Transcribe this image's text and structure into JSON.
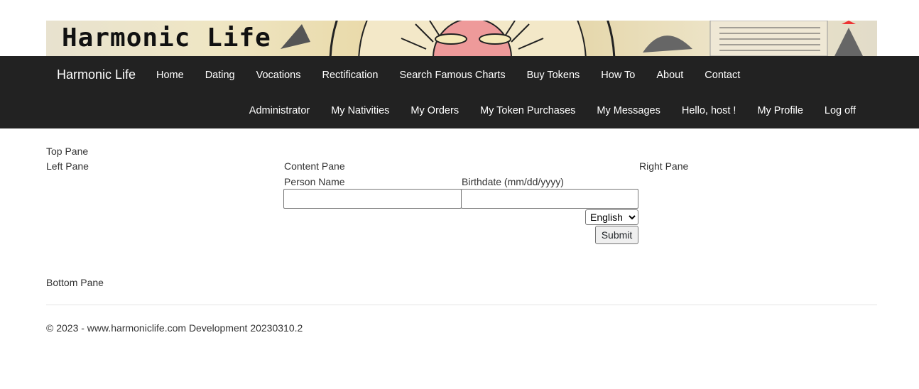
{
  "banner": {
    "title": "Harmonic Life"
  },
  "navbar": {
    "brand": "Harmonic Life",
    "primary": [
      {
        "label": "Home"
      },
      {
        "label": "Dating"
      },
      {
        "label": "Vocations"
      },
      {
        "label": "Rectification"
      },
      {
        "label": "Search Famous Charts"
      },
      {
        "label": "Buy Tokens"
      },
      {
        "label": "How To"
      },
      {
        "label": "About"
      },
      {
        "label": "Contact"
      }
    ],
    "secondary": [
      {
        "label": "Administrator"
      },
      {
        "label": "My Nativities"
      },
      {
        "label": "My Orders"
      },
      {
        "label": "My Token Purchases"
      },
      {
        "label": "My Messages"
      },
      {
        "label": "Hello, host !"
      },
      {
        "label": "My Profile"
      },
      {
        "label": "Log off"
      }
    ]
  },
  "panes": {
    "top": "Top Pane",
    "left": "Left Pane",
    "content": "Content Pane",
    "right": "Right Pane",
    "bottom": "Bottom Pane"
  },
  "form": {
    "person_name_label": "Person Name",
    "person_name_value": "",
    "birthdate_label": "Birthdate (mm/dd/yyyy)",
    "birthdate_value": "",
    "language_selected": "English",
    "submit_label": "Submit"
  },
  "footer": {
    "text": "© 2023 - www.harmoniclife.com Development 20230310.2"
  }
}
